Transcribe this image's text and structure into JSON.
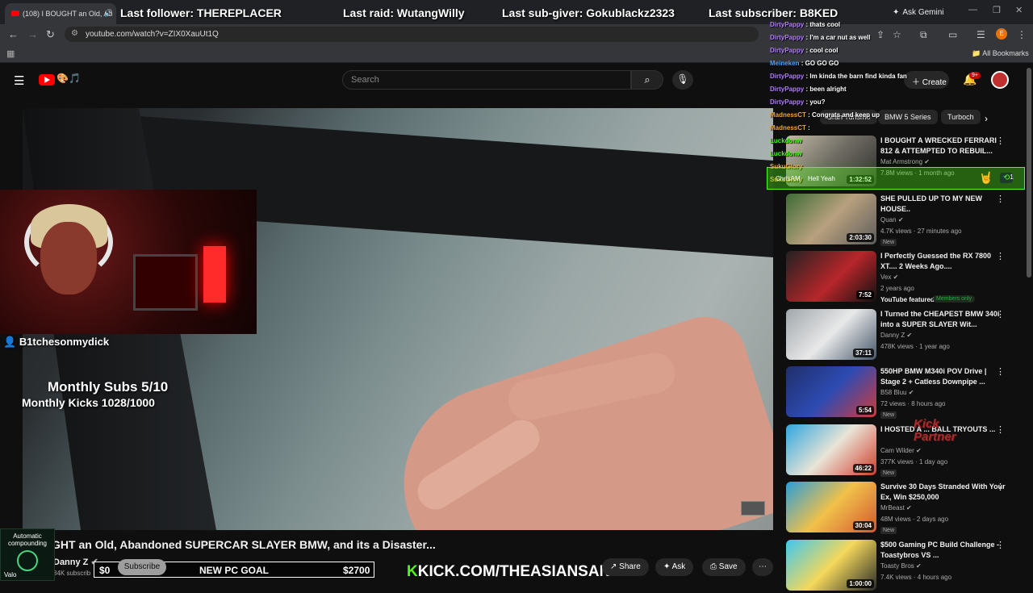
{
  "browser": {
    "tab_title": "(108) I BOUGHT an Old, Ab",
    "url": "youtube.com/watch?v=ZIX0XauUt1Q",
    "ask_gemini": "Ask Gemini",
    "all_bookmarks": "All Bookmarks",
    "profile_initial": "E"
  },
  "stream_overlay": {
    "last_follower": "Last follower: THEREPLACER",
    "last_raid": "Last raid: WutangWilly",
    "last_sub_giver": "Last sub-giver: Gokublackz2323",
    "last_subscriber": "Last subscriber: B8KED",
    "cam_name": "B1tchesonmydick",
    "monthly_subs": "Monthly Subs 5/10",
    "monthly_kicks": "Monthly Kicks 1028/1000",
    "goal_left": "$0",
    "goal_label": "NEW PC GOAL",
    "goal_right": "$2700",
    "kick_url": "KICK.COM/THEASIANSANTA",
    "auto_compound": "Automatic compounding",
    "auto_sub": "Valo",
    "partner": "Kick Partner"
  },
  "youtube": {
    "search_placeholder": "Search",
    "create_label": "Create",
    "notif_badge": "9+",
    "video_title": "GHT an Old, Abandoned SUPERCAR SLAYER BMW, and its a Disaster...",
    "channel": "Danny Z",
    "subscribers": "84K subscrib",
    "subscribe_label": "Subscribe",
    "share_label": "Share",
    "ask_label": "Ask",
    "save_label": "Save",
    "chips": [
      "Gran Turismo",
      "BMW 5 Series",
      "Turboch"
    ]
  },
  "chat": [
    {
      "user": "DirtyPappy",
      "msg": ": thats cool"
    },
    {
      "user": "DirtyPappy",
      "msg": ": I'm a car nut as well"
    },
    {
      "user": "DirtyPappy",
      "msg": ": cool cool"
    },
    {
      "user": "Meineken",
      "msg": ": GO GO GO"
    },
    {
      "user": "DirtyPappy",
      "msg": ": Im kinda the barn find kinda fan"
    },
    {
      "user": "DirtyPappy",
      "msg": ": been alright"
    },
    {
      "user": "DirtyPappy",
      "msg": ": you?"
    },
    {
      "user": "MadnessCT",
      "msg": ": Congrats and keep up"
    },
    {
      "user": "MadnessCT",
      "msg": ":"
    },
    {
      "user": "Luckdonw",
      "msg": ""
    },
    {
      "user": "Luckdonw",
      "msg": ""
    },
    {
      "user": "SukuGlory",
      "msg": ""
    },
    {
      "user": "SukuGlory",
      "msg": ""
    }
  ],
  "follow_alert": {
    "user": "ChrisAM",
    "msg": "Hell Yeah",
    "count": "1"
  },
  "recommendations": [
    {
      "title": "I BOUGHT A WRECKED FERRARI 812 & ATTEMPTED TO REBUIL...",
      "channel": "Mat Armstrong",
      "meta": "7.8M views · 1 month ago",
      "duration": "1:32:52",
      "badge": ""
    },
    {
      "title": "SHE PULLED UP TO MY NEW HOUSE..",
      "channel": "Quan",
      "meta": "4.7K views · 27 minutes ago",
      "duration": "2:03:30",
      "badge": "New"
    },
    {
      "title": "I Perfectly Guessed the RX 7800 XT.... 2 Weeks Ago....",
      "channel": "Vex",
      "meta": "2 years ago",
      "duration": "7:52",
      "badge": "",
      "featured": "YouTube featured",
      "members": "Members only"
    },
    {
      "title": "I Turned the CHEAPEST BMW 340i into a SUPER SLAYER Wit...",
      "channel": "Danny Z",
      "meta": "478K views · 1 year ago",
      "duration": "37:11",
      "badge": ""
    },
    {
      "title": "550HP BMW M340i POV Drive | Stage 2 + Catless Downpipe ...",
      "channel": "B58 Bluu",
      "meta": "72 views · 8 hours ago",
      "duration": "5:54",
      "badge": "New"
    },
    {
      "title": "I HOSTED A ... BALL TRYOUTS ...",
      "channel": "Cam Wilder",
      "meta": "377K views · 1 day ago",
      "duration": "46:22",
      "badge": "New"
    },
    {
      "title": "Survive 30 Days Stranded With Your Ex, Win $250,000",
      "channel": "MrBeast",
      "meta": "48M views · 2 days ago",
      "duration": "30:04",
      "badge": "New"
    },
    {
      "title": "$500 Gaming PC Build Challenge - Toastybros VS ...",
      "channel": "Toasty Bros",
      "meta": "7.4K views · 4 hours ago",
      "duration": "1:00:00",
      "badge": ""
    }
  ],
  "colors": {
    "kick_green": "#53fc18",
    "yt_red": "#ff0000",
    "bg": "#0f0f0f"
  }
}
